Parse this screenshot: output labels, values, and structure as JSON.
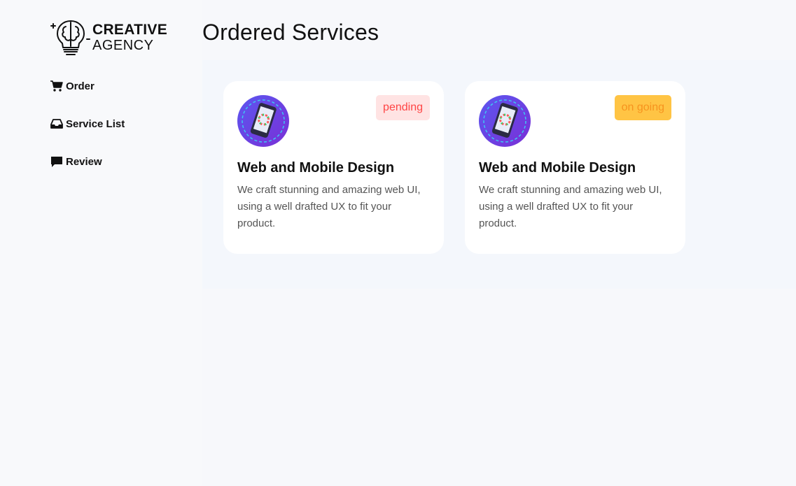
{
  "brand": {
    "line1": "CREATIVE",
    "line2": "AGENCY"
  },
  "sidebar": {
    "items": [
      {
        "label": "Order",
        "icon": "cart-icon"
      },
      {
        "label": "Service List",
        "icon": "inbox-icon"
      },
      {
        "label": "Review",
        "icon": "message-icon"
      }
    ]
  },
  "page": {
    "title": "Ordered Services"
  },
  "orders": [
    {
      "title": "Web and Mobile Design",
      "description": "We craft stunning and amazing web UI, using a well drafted UX to fit your product.",
      "status": "pending",
      "icon": "mobile-design-icon"
    },
    {
      "title": "Web and Mobile Design",
      "description": "We craft stunning and amazing web UI, using a well drafted UX to fit your product.",
      "status": "on going",
      "icon": "mobile-design-icon"
    }
  ],
  "colors": {
    "pending_bg": "#ffe3e3",
    "pending_text": "#ff4545",
    "ongoing_bg": "#ffc444",
    "ongoing_text": "#f7931e"
  }
}
